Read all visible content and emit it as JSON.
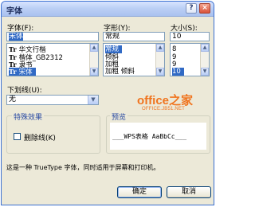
{
  "window": {
    "title": "字体",
    "help_btn": "?",
    "close_btn": "×"
  },
  "font": {
    "label": "字体(F):",
    "value": "宋体",
    "items": [
      {
        "glyph": "Tr",
        "name": "华文行楷",
        "selected": false
      },
      {
        "glyph": "Tr",
        "name": "楷体_GB2312",
        "selected": false
      },
      {
        "glyph": "Tr",
        "name": "隶书",
        "selected": false
      },
      {
        "glyph": "Tr",
        "name": "宋体",
        "selected": true
      }
    ]
  },
  "style": {
    "label": "字形(Y):",
    "value": "常规",
    "items": [
      "常规",
      "倾斜",
      "加粗",
      "加粗 倾斜"
    ],
    "selected_index": 0
  },
  "size": {
    "label": "大小(S):",
    "value": "10",
    "items": [
      "8",
      "9",
      "9",
      "10"
    ],
    "selected_index": 3
  },
  "underline": {
    "label": "下划线(U):",
    "value": "无"
  },
  "effects": {
    "label": "特殊效果",
    "strikeout_label": "删除线(K)",
    "strikeout_checked": false
  },
  "preview": {
    "label": "预览",
    "sample": "___WPS表格 AaBbCc___"
  },
  "info_text": "这是一种 TrueType 字体，同时适用于屏幕和打印机。",
  "buttons": {
    "ok": "确定",
    "cancel": "取消"
  },
  "watermark": {
    "brand": "office之家",
    "url": "OFFICE.JB51.NET"
  }
}
